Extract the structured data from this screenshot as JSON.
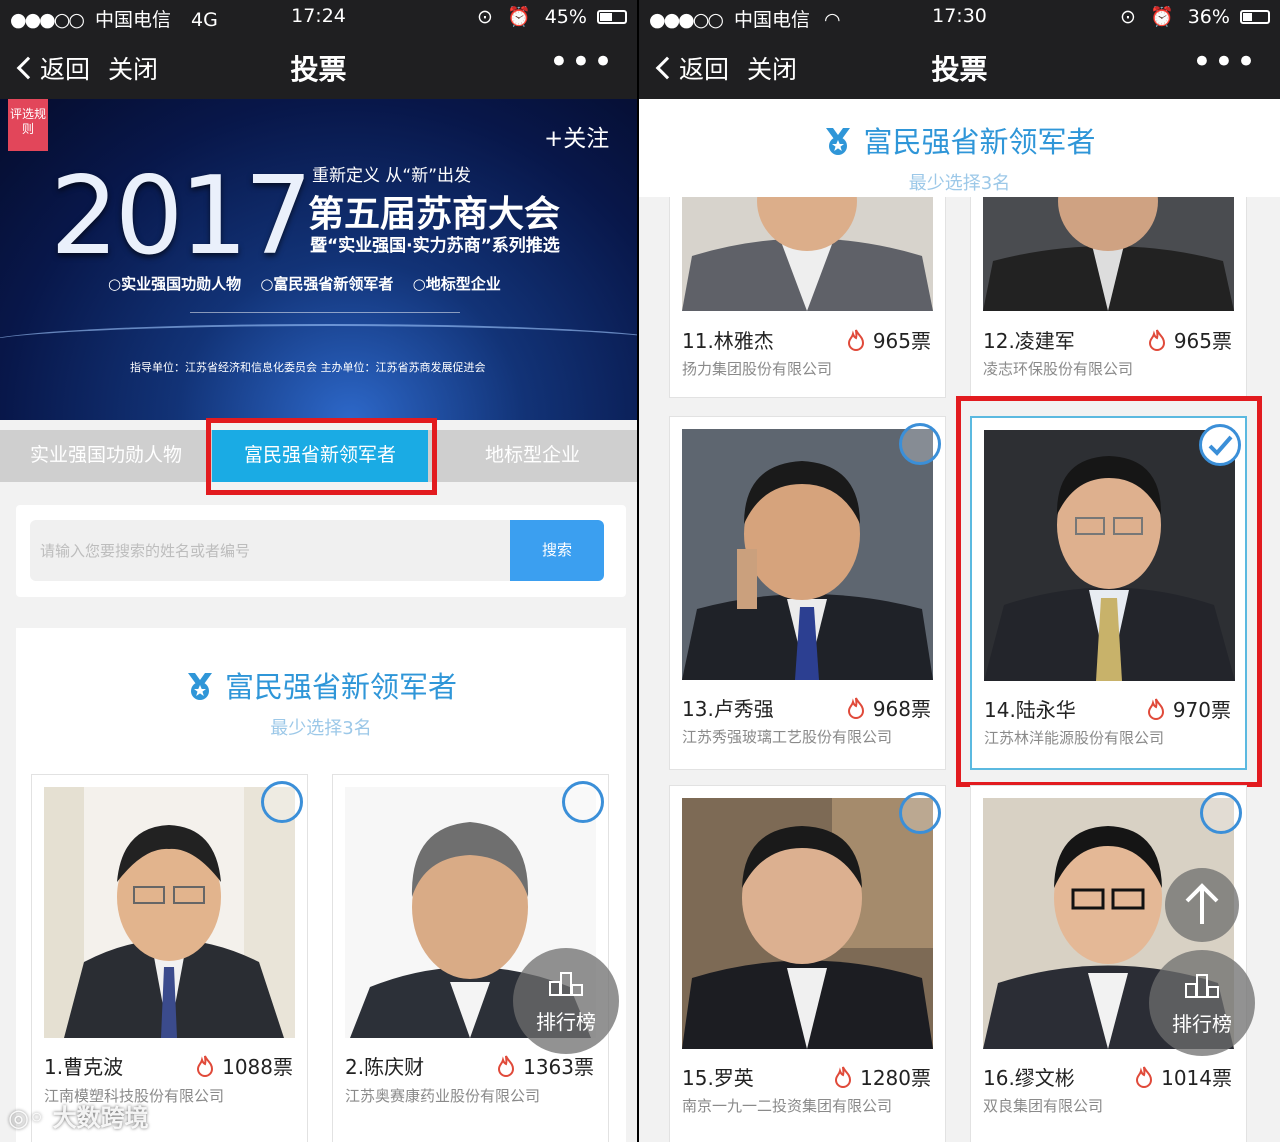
{
  "left": {
    "status": {
      "carrier": "中国电信",
      "network": "4G",
      "time": "17:24",
      "battery": "45%",
      "battery_level": 0.45
    },
    "nav": {
      "back": "返回",
      "close": "关闭",
      "title": "投票",
      "more": "•••"
    },
    "banner": {
      "ribbon": "评选规则",
      "follow": "+关注",
      "year": "2017",
      "line1": "重新定义 从“新”出发",
      "line2": "第五届苏商大会",
      "line3": "暨“实业强国·实力苏商”系列推选",
      "categories": [
        "○实业强国功勋人物",
        "○富民强省新领军者",
        "○地标型企业"
      ],
      "organizers": "指导单位：江苏省经济和信息化委员会    主办单位：江苏省苏商发展促进会"
    },
    "tabs": [
      "实业强国功勋人物",
      "富民强省新领军者",
      "地标型企业"
    ],
    "search": {
      "placeholder": "请输入您要搜索的姓名或者编号",
      "button": "搜索"
    },
    "section": {
      "title": "富民强省新领军者",
      "subtitle": "最少选择3名"
    },
    "candidates": [
      {
        "name": "1.曹克波",
        "votes": "1088票",
        "company": "江南模塑科技股份有限公司"
      },
      {
        "name": "2.陈庆财",
        "votes": "1363票",
        "company": "江苏奥赛康药业股份有限公司"
      }
    ],
    "ranking": "排行榜",
    "watermark": "大数跨境"
  },
  "right": {
    "status": {
      "carrier": "中国电信",
      "time": "17:30",
      "battery": "36%",
      "battery_level": 0.36
    },
    "nav": {
      "back": "返回",
      "close": "关闭",
      "title": "投票",
      "more": "•••"
    },
    "section": {
      "title": "富民强省新领军者",
      "subtitle": "最少选择3名"
    },
    "candidates": [
      {
        "name": "11.林雅杰",
        "votes": "965票",
        "company": "扬力集团股份有限公司"
      },
      {
        "name": "12.凌建军",
        "votes": "965票",
        "company": "凌志环保股份有限公司"
      },
      {
        "name": "13.卢秀强",
        "votes": "968票",
        "company": "江苏秀强玻璃工艺股份有限公司"
      },
      {
        "name": "14.陆永华",
        "votes": "970票",
        "company": "江苏林洋能源股份有限公司"
      },
      {
        "name": "15.罗英",
        "votes": "1280票",
        "company": "南京一九一二投资集团有限公司"
      },
      {
        "name": "16.缪文彬",
        "votes": "1014票",
        "company": "双良集团有限公司"
      }
    ],
    "ranking": "排行榜"
  },
  "colors": {
    "accent_blue": "#1aabe4",
    "highlight_red": "#e21b1f",
    "title_blue": "#2f96d8",
    "nav_bg": "#1f1f21"
  }
}
